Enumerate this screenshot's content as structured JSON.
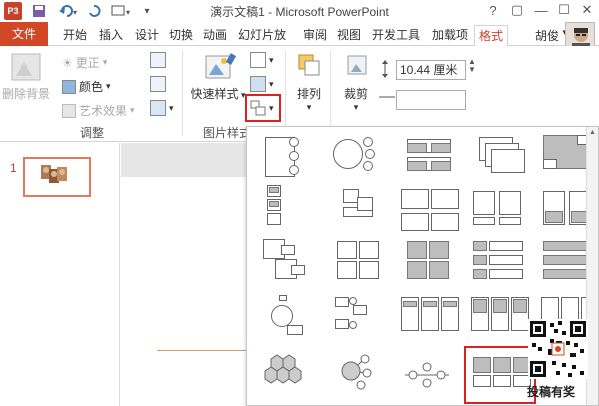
{
  "titlebar": {
    "app_icon": "P3",
    "title": "演示文稿1 - Microsoft PowerPoint",
    "help": "?",
    "restore": "▢",
    "minimize": "—",
    "maximize": "☐",
    "close": "✕"
  },
  "tabs": {
    "file": "文件",
    "items": [
      "开始",
      "插入",
      "设计",
      "切换",
      "动画",
      "幻灯片放",
      "审阅",
      "视图",
      "开发工具",
      "加载项",
      "格式"
    ],
    "active": "格式",
    "user": "胡俊"
  },
  "ribbon": {
    "remove_bg": "删除背景",
    "corrections": "更正",
    "color": "颜色",
    "art_effects": "艺术效果",
    "adjust_group": "调整",
    "quick_styles": "快速样式",
    "picture_styles_group": "图片样式",
    "arrange": "排列",
    "crop": "裁剪",
    "height_value": "10.44 厘米"
  },
  "slide_pane": {
    "slide_number": "1"
  },
  "watermark": {
    "label": "投稿有奖"
  },
  "icons": [
    "save-icon",
    "undo-icon",
    "redo-icon",
    "quick-styles-icon",
    "picture-layout-icon",
    "arrange-icon",
    "crop-icon"
  ]
}
